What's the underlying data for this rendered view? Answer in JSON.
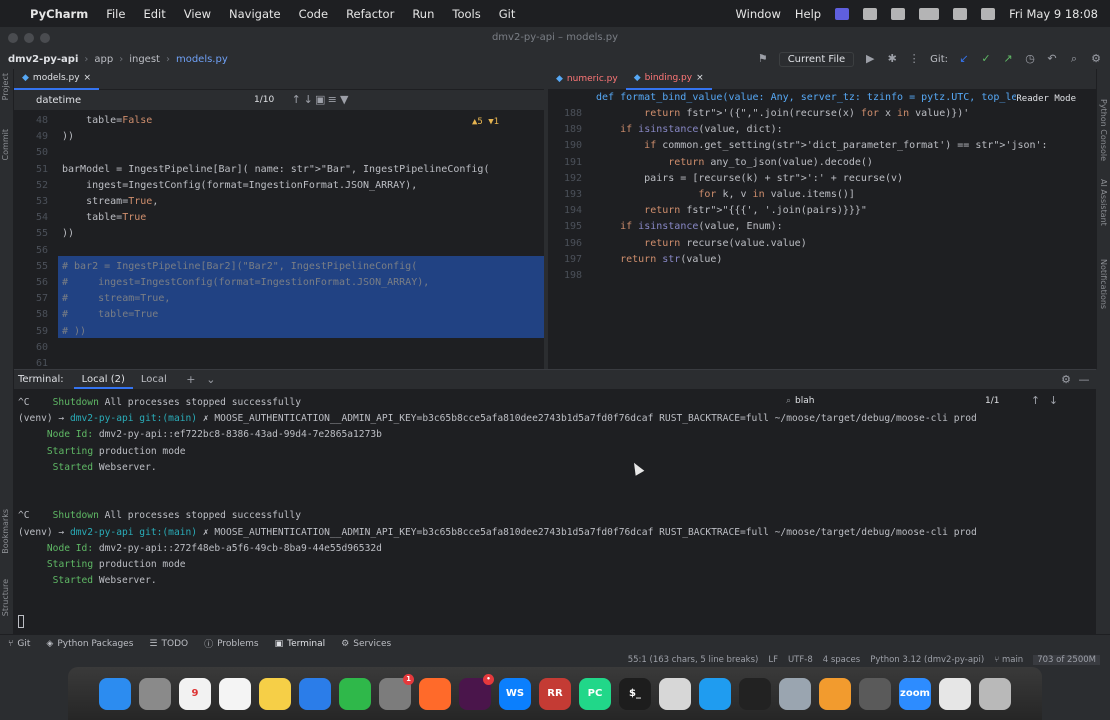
{
  "menubar": {
    "app": "PyCharm",
    "items": [
      "File",
      "Edit",
      "View",
      "Navigate",
      "Code",
      "Refactor",
      "Run",
      "Tools",
      "Git"
    ],
    "right_items": [
      "Window",
      "Help"
    ],
    "clock": "Fri May 9  18:08"
  },
  "window": {
    "title": "dmv2-py-api – models.py"
  },
  "toolbar": {
    "crumbs": [
      "dmv2-py-api",
      "app",
      "ingest",
      "models.py"
    ],
    "run_config": "Current File",
    "git_label": "Git:"
  },
  "left_editor": {
    "tabs": [
      {
        "label": "models.py",
        "active": true
      }
    ],
    "find_query": "datetime",
    "find_count": "1/10",
    "inspections": "▲5  ▼1",
    "lines": [
      {
        "n": "48",
        "text": "    table=False"
      },
      {
        "n": "49",
        "text": "))"
      },
      {
        "n": "50",
        "text": ""
      },
      {
        "n": "51",
        "text": "barModel = IngestPipeline[Bar]( name: \"Bar\", IngestPipelineConfig("
      },
      {
        "n": "52",
        "text": "    ingest=IngestConfig(format=IngestionFormat.JSON_ARRAY),"
      },
      {
        "n": "53",
        "text": "    stream=True,"
      },
      {
        "n": "54",
        "text": "    table=True"
      },
      {
        "n": "55",
        "text": "))"
      },
      {
        "n": "56",
        "text": ""
      },
      {
        "n": "55",
        "text": "# bar2 = IngestPipeline[Bar2](\"Bar2\", IngestPipelineConfig("
      },
      {
        "n": "56",
        "text": "#     ingest=IngestConfig(format=IngestionFormat.JSON_ARRAY),"
      },
      {
        "n": "57",
        "text": "#     stream=True,"
      },
      {
        "n": "58",
        "text": "#     table=True"
      },
      {
        "n": "59",
        "text": "# ))"
      },
      {
        "n": "60",
        "text": ""
      },
      {
        "n": "61",
        "text": ""
      }
    ]
  },
  "right_editor": {
    "tabs": [
      {
        "label": "numeric.py",
        "active": false
      },
      {
        "label": "binding.py",
        "active": true
      }
    ],
    "reader_mode": "Reader Mode",
    "header_line": "def format_bind_value(value: Any, server_tz: tzinfo = pytz.UTC, top_le",
    "lines": [
      {
        "n": "188",
        "text": "        return f'({\",\".join(recurse(x) for x in value)})'"
      },
      {
        "n": "189",
        "text": "    if isinstance(value, dict):"
      },
      {
        "n": "190",
        "text": "        if common.get_setting('dict_parameter_format') == 'json':"
      },
      {
        "n": "191",
        "text": "            return any_to_json(value).decode()"
      },
      {
        "n": "192",
        "text": "        pairs = [recurse(k) + ':' + recurse(v)"
      },
      {
        "n": "193",
        "text": "                 for k, v in value.items()]"
      },
      {
        "n": "194",
        "text": "        return f\"{{{', '.join(pairs)}}}\""
      },
      {
        "n": "195",
        "text": "    if isinstance(value, Enum):"
      },
      {
        "n": "196",
        "text": "        return recurse(value.value)"
      },
      {
        "n": "197",
        "text": "    return str(value)"
      },
      {
        "n": "198",
        "text": ""
      }
    ]
  },
  "terminal": {
    "label": "Terminal:",
    "tabs": [
      {
        "label": "Local (2)",
        "active": true
      },
      {
        "label": "Local",
        "active": false
      }
    ],
    "search": "blah",
    "search_count": "1/1",
    "lines": [
      "^C    Shutdown All processes stopped successfully",
      "(venv) → dmv2-py-api git:(main) ✗ MOOSE_AUTHENTICATION__ADMIN_API_KEY=b3c65b8cce5afa810dee2743b1d5a7fd0f76dcaf RUST_BACKTRACE=full ~/moose/target/debug/moose-cli prod",
      "     Node Id: dmv2-py-api::ef722bc8-8386-43ad-99d4-7e2865a1273b",
      "     Starting production mode",
      "      Started Webserver.",
      "",
      "",
      "^C    Shutdown All processes stopped successfully",
      "(venv) → dmv2-py-api git:(main) ✗ MOOSE_AUTHENTICATION__ADMIN_API_KEY=b3c65b8cce5afa810dee2743b1d5a7fd0f76dcaf RUST_BACKTRACE=full ~/moose/target/debug/moose-cli prod",
      "     Node Id: dmv2-py-api::272f48eb-a5f6-49cb-8ba9-44e55d96532d",
      "     Starting production mode",
      "      Started Webserver."
    ]
  },
  "bottom_tabs": [
    "Git",
    "Python Packages",
    "TODO",
    "Problems",
    "Terminal",
    "Services"
  ],
  "status": {
    "position": "55:1 (163 chars, 5 line breaks)",
    "line_sep": "LF",
    "encoding": "UTF-8",
    "indent": "4 spaces",
    "interpreter": "Python 3.12 (dmv2-py-api)",
    "branch": "main",
    "memory": "703 of 2500M"
  },
  "side_labels": {
    "left": [
      "Project",
      "Commit",
      "Bookmarks",
      "Structure"
    ],
    "right": [
      "Python Console",
      "AI Assistant",
      "Notifications"
    ]
  },
  "dock": [
    {
      "name": "Finder",
      "color": "#2c8cf0"
    },
    {
      "name": "Launchpad",
      "color": "#8a8a8a"
    },
    {
      "name": "Calendar",
      "color": "#f2f2f2",
      "text": "9"
    },
    {
      "name": "Reminders",
      "color": "#f4f4f4"
    },
    {
      "name": "Notes",
      "color": "#f6cf47"
    },
    {
      "name": "Keynote",
      "color": "#2b7de9"
    },
    {
      "name": "Numbers",
      "color": "#2fb84a"
    },
    {
      "name": "Settings",
      "color": "#7c7c7c",
      "badge": "1"
    },
    {
      "name": "Firefox",
      "color": "#ff6a2a"
    },
    {
      "name": "Slack",
      "color": "#4a154b",
      "badge": "•"
    },
    {
      "name": "WebStorm",
      "color": "#0b7ffd",
      "text": "WS"
    },
    {
      "name": "RustRover",
      "color": "#c43b34",
      "text": "RR"
    },
    {
      "name": "PyCharm",
      "color": "#21d789",
      "text": "PC"
    },
    {
      "name": "Terminal",
      "color": "#1d1d1d",
      "text": "$_"
    },
    {
      "name": "Unity",
      "color": "#d7d7d7"
    },
    {
      "name": "VS Code",
      "color": "#1f9cf0"
    },
    {
      "name": "Activity",
      "color": "#222"
    },
    {
      "name": "Preview",
      "color": "#9aa5b0"
    },
    {
      "name": "Sublime",
      "color": "#f29b2e"
    },
    {
      "name": "TablePlus",
      "color": "#5a5a5a"
    },
    {
      "name": "Zoom",
      "color": "#2d8cff",
      "text": "zoom"
    },
    {
      "name": "Files",
      "color": "#e6e6e6"
    },
    {
      "name": "Trash",
      "color": "#b9b9b9"
    }
  ]
}
